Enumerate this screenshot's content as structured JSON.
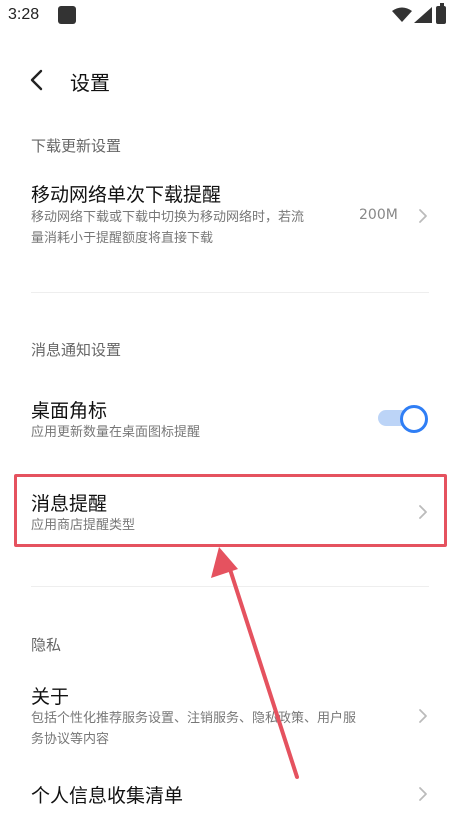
{
  "status_bar": {
    "time": "3:28"
  },
  "header": {
    "title": "设置"
  },
  "sections": {
    "download": {
      "title": "下载更新设置",
      "mobile_download": {
        "title": "移动网络单次下载提醒",
        "subtitle_line1": "移动网络下载或下载中切换为移动网络时，若流",
        "subtitle_line2": "量消耗小于提醒额度将直接下载",
        "value": "200M"
      }
    },
    "notification": {
      "title": "消息通知设置",
      "badge": {
        "title": "桌面角标",
        "subtitle": "应用更新数量在桌面图标提醒",
        "enabled": true
      },
      "message_reminder": {
        "title": "消息提醒",
        "subtitle": "应用商店提醒类型"
      }
    },
    "privacy": {
      "title": "隐私",
      "about": {
        "title": "关于",
        "subtitle_line1": "包括个性化推荐服务设置、注销服务、隐私政策、用户服",
        "subtitle_line2": "务协议等内容"
      },
      "personal_info": {
        "title": "个人信息收集清单"
      }
    }
  },
  "colors": {
    "accent": "#2f7ef5",
    "highlight": "#e5525f"
  }
}
